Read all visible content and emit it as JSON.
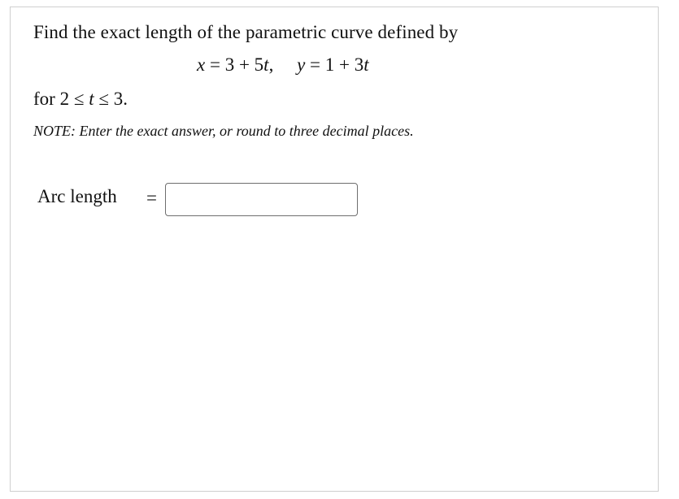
{
  "question": {
    "intro": "Find the exact length of the parametric curve defined by",
    "equations": {
      "x_var": "x",
      "x_rhs": " = 3 + 5",
      "x_t": "t",
      "separator": ",     ",
      "y_var": "y",
      "y_rhs": " = 1 + 3",
      "y_t": "t"
    },
    "range": {
      "prefix": "for 2 ≤ ",
      "var": "t",
      "suffix": " ≤ 3."
    },
    "note": "NOTE: Enter the exact answer, or round to three decimal places."
  },
  "answer": {
    "label": "Arc length",
    "equals": "=",
    "value": "",
    "placeholder": ""
  }
}
